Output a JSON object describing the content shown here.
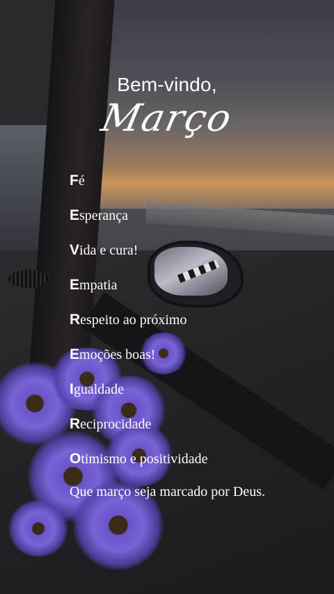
{
  "greeting": "Bem-vindo,",
  "month": "Março",
  "acrostic": [
    {
      "initial": "F",
      "rest": "é"
    },
    {
      "initial": "E",
      "rest": "sperança"
    },
    {
      "initial": "V",
      "rest": "ida e cura!"
    },
    {
      "initial": "E",
      "rest": "mpatia"
    },
    {
      "initial": "R",
      "rest": "espeito ao próximo"
    },
    {
      "initial": "E",
      "rest": "moções boas!"
    },
    {
      "initial": "I",
      "rest": "gualdade"
    },
    {
      "initial": "R",
      "rest": "eciprocidade"
    },
    {
      "initial": "O",
      "rest": "timismo e positividade"
    }
  ],
  "closing": "Que março seja marcado por Deus.",
  "colors": {
    "text": "#ffffff",
    "flower": "#7a63d6",
    "sunset": "#c9955a"
  }
}
